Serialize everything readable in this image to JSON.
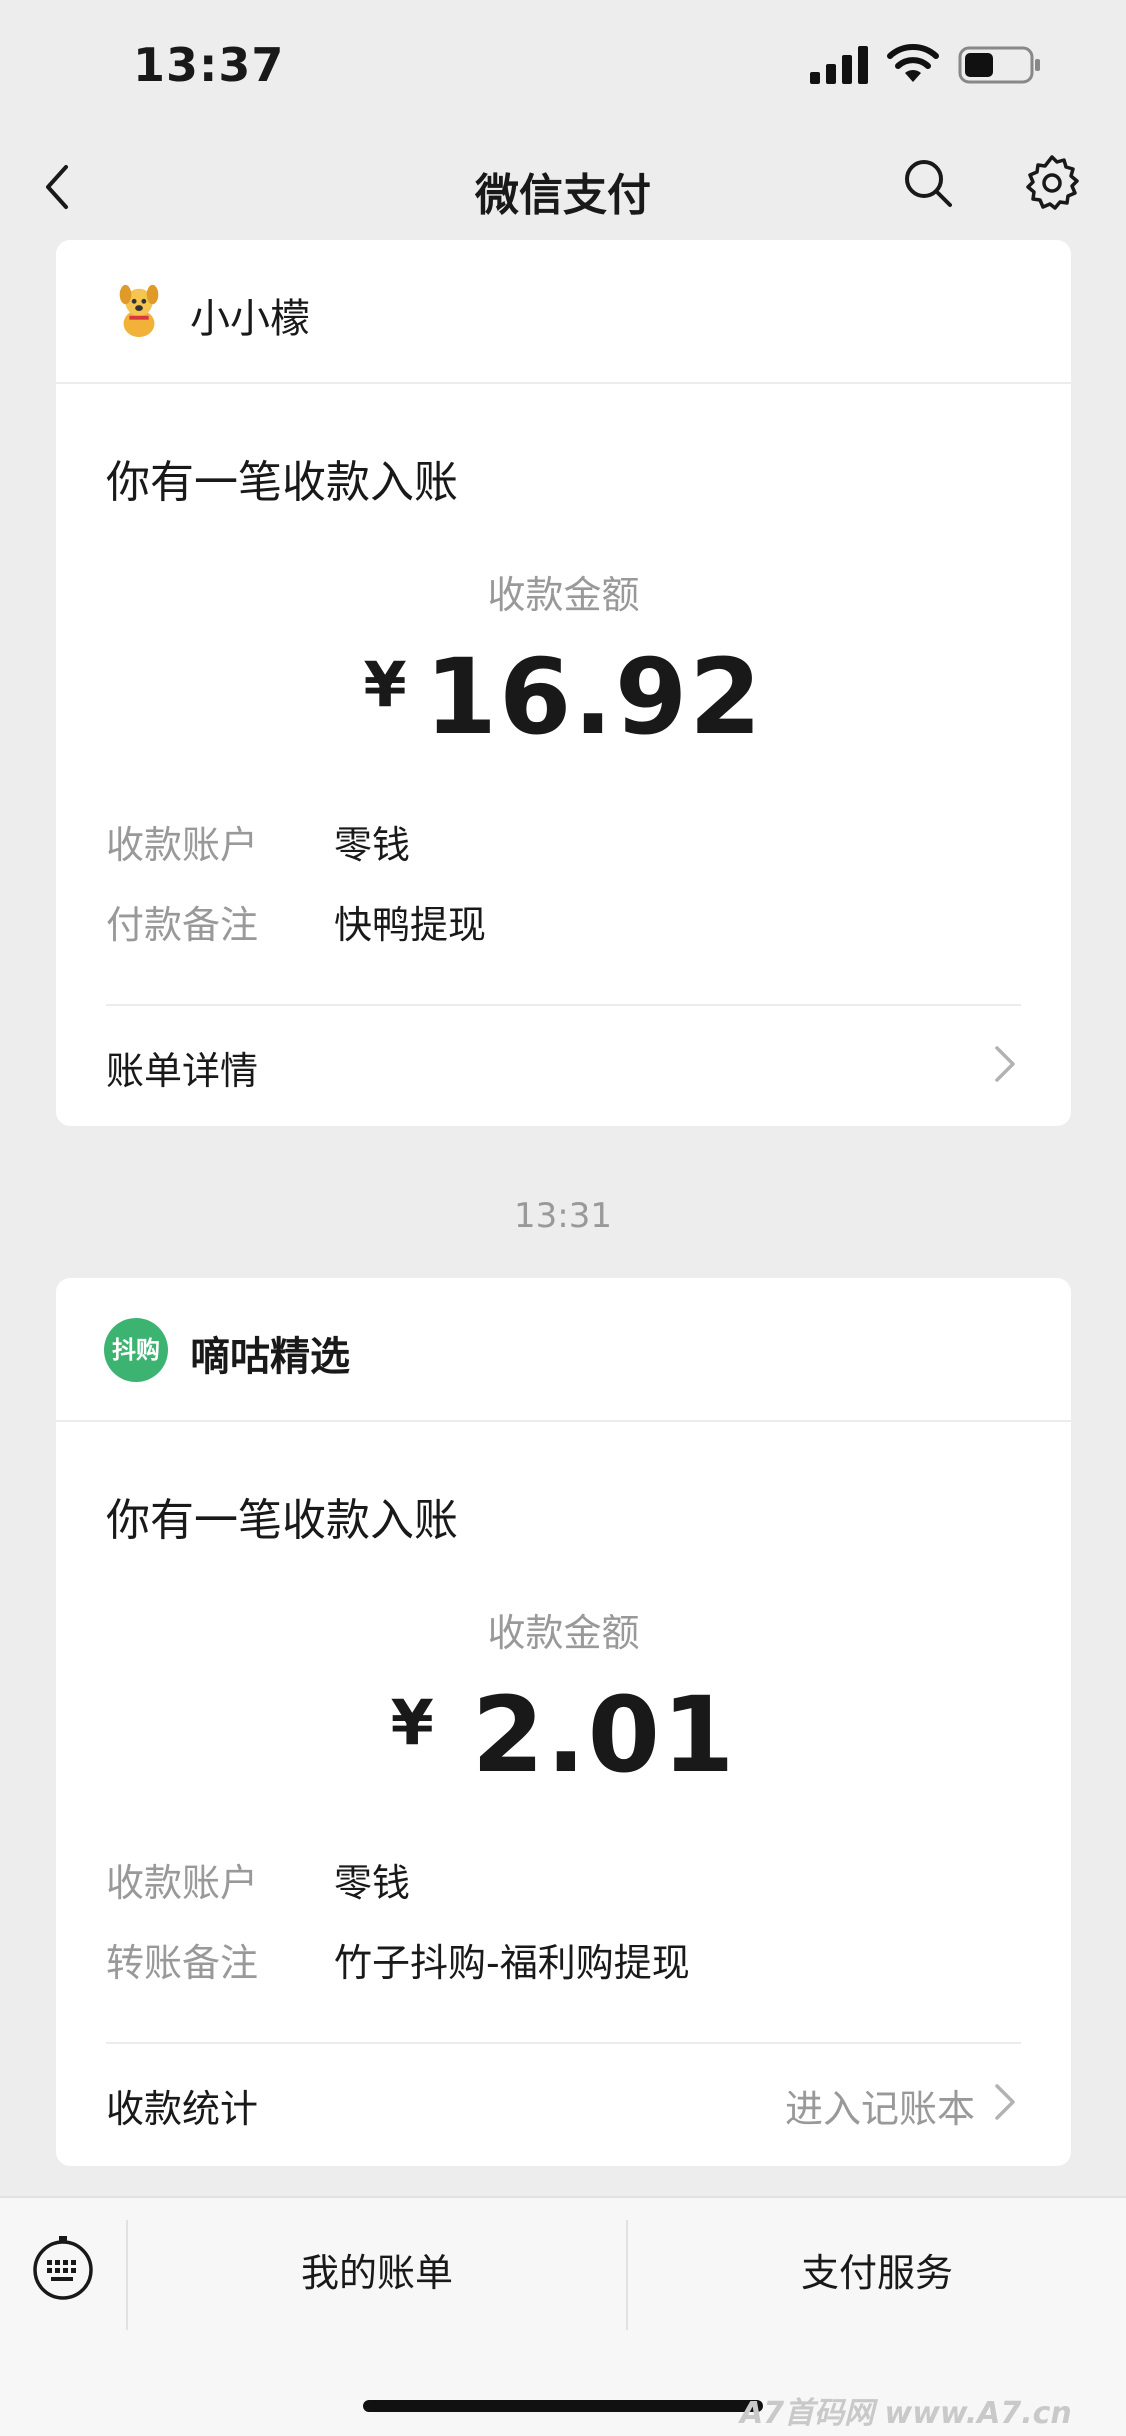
{
  "status_bar": {
    "time": "13:37"
  },
  "nav": {
    "title": "微信支付"
  },
  "cards": [
    {
      "merchant": "小小檬",
      "headline": "你有一笔收款入账",
      "amount_label": "收款金额",
      "currency": "¥",
      "amount": "16.92",
      "rows": [
        {
          "label": "收款账户",
          "value": "零钱"
        },
        {
          "label": "付款备注",
          "value": "快鸭提现"
        }
      ],
      "footer_left": "账单详情",
      "footer_right": ""
    },
    {
      "merchant": "嘀咕精选",
      "logo_text": "抖购",
      "headline": "你有一笔收款入账",
      "amount_label": "收款金额",
      "currency": "¥",
      "amount": "2.01",
      "rows": [
        {
          "label": "收款账户",
          "value": "零钱"
        },
        {
          "label": "转账备注",
          "value": "竹子抖购-福利购提现"
        }
      ],
      "footer_left": "收款统计",
      "footer_right": "进入记账本"
    }
  ],
  "timestamp": "13:31",
  "bottom_bar": {
    "tabs": [
      "我的账单",
      "支付服务"
    ]
  },
  "watermark": "A7首码网 www.A7.cn",
  "colors": {
    "background": "#ededed",
    "card": "#ffffff",
    "secondary_text": "#999999",
    "logo_green": "#3cb371"
  }
}
